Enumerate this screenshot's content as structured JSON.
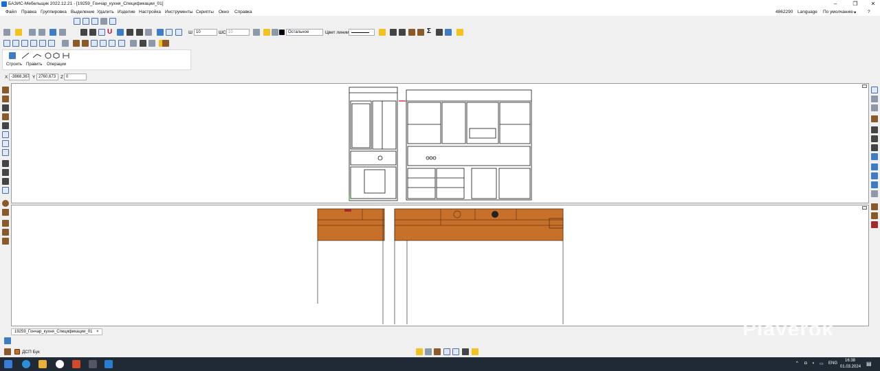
{
  "window": {
    "title": "БАЗИС-Мебельщик 2022.12.21 - [19259_Гончар_кухня_Спецификации_01]",
    "minimize": "–",
    "maximize": "❐",
    "close": "✕"
  },
  "menu": {
    "items": [
      "Файл",
      "Правка",
      "Группировка",
      "Выделение",
      "Удалить",
      "Изделие",
      "Настройка",
      "Инструменты",
      "Скрипты",
      "Окно",
      "Справка"
    ],
    "license": "4862290",
    "language": "Language",
    "layout": "По умолчанию"
  },
  "toolbar": {
    "w_label": "Ш",
    "w_value": "10",
    "shs_label": "ШС",
    "shs_value": "10",
    "layer_value": "Остальное",
    "line_color_label": "Цвет линии",
    "sigma": "Σ"
  },
  "build_panel": {
    "tabs": [
      "Строить",
      "Править",
      "Операции"
    ]
  },
  "coords": {
    "x_label": "X",
    "x_value": "-3868,367",
    "y_label": "Y",
    "y_value": "2760,673",
    "z_label": "Z",
    "z_value": "0"
  },
  "document_tab": {
    "label": "19259_Гончар_кухня_Спецификации_01",
    "close": "×"
  },
  "status": {
    "material": "ДСП Бук"
  },
  "taskbar": {
    "lang": "ENG",
    "time": "16:38",
    "date": "01.03.2024"
  },
  "watermark": "Playerok",
  "colors": {
    "wood": "#c7702a",
    "wood_dark": "#8a4a18",
    "taskbar": "#1f2a35",
    "accent": "#1a6fd1"
  }
}
